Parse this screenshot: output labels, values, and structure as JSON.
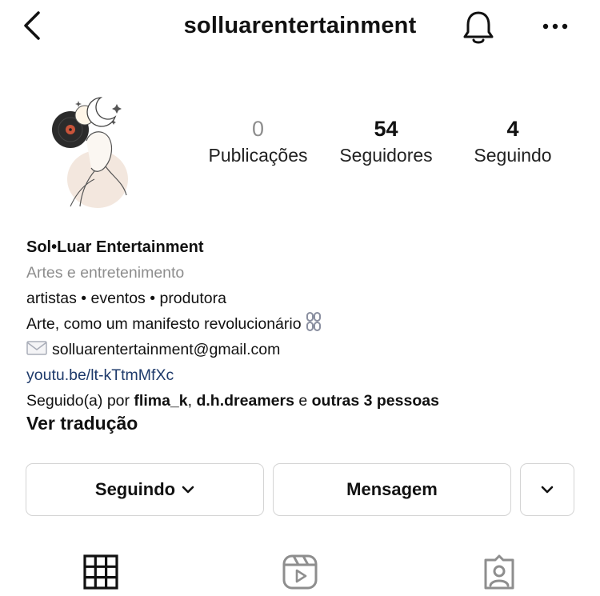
{
  "header": {
    "username": "solluarentertainment"
  },
  "stats": [
    {
      "value": "0",
      "label": "Publicações"
    },
    {
      "value": "54",
      "label": "Seguidores"
    },
    {
      "value": "4",
      "label": "Seguindo"
    }
  ],
  "bio": {
    "name": "Sol•Luar Entertainment",
    "category": "Artes e entretenimento",
    "line1": "artistas • eventos • produtora",
    "line2": "Arte, como um manifesto revolucionário",
    "email": "solluarentertainment@gmail.com",
    "link": "youtu.be/lt-kTtmMfXc",
    "followed_prefix": "Seguido(a) por ",
    "followed_user1": "flima_k",
    "followed_sep": ", ",
    "followed_user2": "d.h.dreamers",
    "followed_and": " e ",
    "followed_others": "outras 3 pessoas"
  },
  "translate_label": "Ver tradução",
  "actions": {
    "following_label": "Seguindo",
    "message_label": "Mensagem"
  },
  "icons": {
    "back": "chevron-left-icon",
    "bell": "bell-icon",
    "more": "more-horizontal-icon",
    "mail": "envelope-icon",
    "chain": "chain-icon",
    "grid": "grid-icon",
    "reels": "reels-icon",
    "tagged": "tagged-icon"
  }
}
